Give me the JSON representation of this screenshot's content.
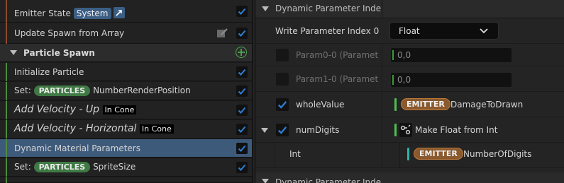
{
  "left": {
    "rows": [
      {
        "label": "Emitter State",
        "badge": "System"
      },
      {
        "label": "Update Spawn from Array"
      },
      {
        "section": "Particle Spawn"
      },
      {
        "label": "Initialize Particle"
      },
      {
        "prefix": "Set:",
        "pill": "PARTICLES",
        "value": "NumberRenderPosition"
      },
      {
        "label": "Add Velocity - Up",
        "tag": "In Cone"
      },
      {
        "label": "Add Velocity - Horizontal",
        "tag": "In Cone"
      },
      {
        "label": "Dynamic Material Parameters"
      },
      {
        "prefix": "Set:",
        "pill": "PARTICLES",
        "value": "SpriteSize"
      }
    ]
  },
  "right": {
    "header1": "Dynamic Parameter Inde",
    "write_param_label": "Write Parameter Index 0",
    "write_param_value": "Float",
    "param0_label": "Param0-0 (Paramet",
    "param0_value": "0,0",
    "param1_label": "Param1-0 (Paramet",
    "param1_value": "0,0",
    "whole_value_label": "wholeValue",
    "whole_value_pill": "EMITTER",
    "whole_value_name": "DamageToDrawn",
    "num_digits_label": "numDigits",
    "num_digits_value": "Make Float from Int",
    "int_label": "Int",
    "int_pill": "EMITTER",
    "int_name": "NumberOfDigits",
    "header2": "Dynamic Parameter Inde"
  },
  "colors": {
    "accent_module": "#8a4a2c",
    "accent_particle": "#4c8c3c",
    "check": "#2f7fd6",
    "selected": "#3e5a7a"
  }
}
